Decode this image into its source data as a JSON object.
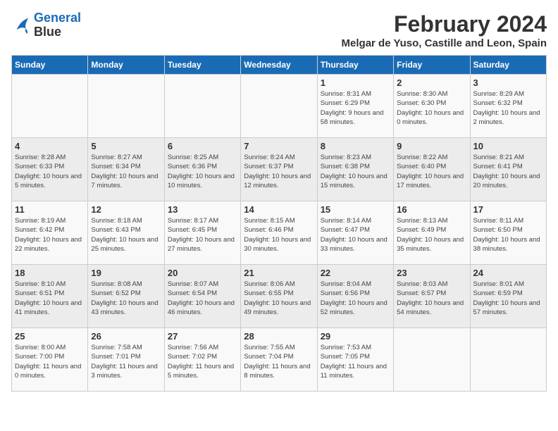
{
  "header": {
    "logo_line1": "General",
    "logo_line2": "Blue",
    "title": "February 2024",
    "subtitle": "Melgar de Yuso, Castille and Leon, Spain"
  },
  "columns": [
    "Sunday",
    "Monday",
    "Tuesday",
    "Wednesday",
    "Thursday",
    "Friday",
    "Saturday"
  ],
  "weeks": [
    [
      {
        "day": "",
        "detail": ""
      },
      {
        "day": "",
        "detail": ""
      },
      {
        "day": "",
        "detail": ""
      },
      {
        "day": "",
        "detail": ""
      },
      {
        "day": "1",
        "detail": "Sunrise: 8:31 AM\nSunset: 6:29 PM\nDaylight: 9 hours\nand 58 minutes."
      },
      {
        "day": "2",
        "detail": "Sunrise: 8:30 AM\nSunset: 6:30 PM\nDaylight: 10 hours\nand 0 minutes."
      },
      {
        "day": "3",
        "detail": "Sunrise: 8:29 AM\nSunset: 6:32 PM\nDaylight: 10 hours\nand 2 minutes."
      }
    ],
    [
      {
        "day": "4",
        "detail": "Sunrise: 8:28 AM\nSunset: 6:33 PM\nDaylight: 10 hours\nand 5 minutes."
      },
      {
        "day": "5",
        "detail": "Sunrise: 8:27 AM\nSunset: 6:34 PM\nDaylight: 10 hours\nand 7 minutes."
      },
      {
        "day": "6",
        "detail": "Sunrise: 8:25 AM\nSunset: 6:36 PM\nDaylight: 10 hours\nand 10 minutes."
      },
      {
        "day": "7",
        "detail": "Sunrise: 8:24 AM\nSunset: 6:37 PM\nDaylight: 10 hours\nand 12 minutes."
      },
      {
        "day": "8",
        "detail": "Sunrise: 8:23 AM\nSunset: 6:38 PM\nDaylight: 10 hours\nand 15 minutes."
      },
      {
        "day": "9",
        "detail": "Sunrise: 8:22 AM\nSunset: 6:40 PM\nDaylight: 10 hours\nand 17 minutes."
      },
      {
        "day": "10",
        "detail": "Sunrise: 8:21 AM\nSunset: 6:41 PM\nDaylight: 10 hours\nand 20 minutes."
      }
    ],
    [
      {
        "day": "11",
        "detail": "Sunrise: 8:19 AM\nSunset: 6:42 PM\nDaylight: 10 hours\nand 22 minutes."
      },
      {
        "day": "12",
        "detail": "Sunrise: 8:18 AM\nSunset: 6:43 PM\nDaylight: 10 hours\nand 25 minutes."
      },
      {
        "day": "13",
        "detail": "Sunrise: 8:17 AM\nSunset: 6:45 PM\nDaylight: 10 hours\nand 27 minutes."
      },
      {
        "day": "14",
        "detail": "Sunrise: 8:15 AM\nSunset: 6:46 PM\nDaylight: 10 hours\nand 30 minutes."
      },
      {
        "day": "15",
        "detail": "Sunrise: 8:14 AM\nSunset: 6:47 PM\nDaylight: 10 hours\nand 33 minutes."
      },
      {
        "day": "16",
        "detail": "Sunrise: 8:13 AM\nSunset: 6:49 PM\nDaylight: 10 hours\nand 35 minutes."
      },
      {
        "day": "17",
        "detail": "Sunrise: 8:11 AM\nSunset: 6:50 PM\nDaylight: 10 hours\nand 38 minutes."
      }
    ],
    [
      {
        "day": "18",
        "detail": "Sunrise: 8:10 AM\nSunset: 6:51 PM\nDaylight: 10 hours\nand 41 minutes."
      },
      {
        "day": "19",
        "detail": "Sunrise: 8:08 AM\nSunset: 6:52 PM\nDaylight: 10 hours\nand 43 minutes."
      },
      {
        "day": "20",
        "detail": "Sunrise: 8:07 AM\nSunset: 6:54 PM\nDaylight: 10 hours\nand 46 minutes."
      },
      {
        "day": "21",
        "detail": "Sunrise: 8:06 AM\nSunset: 6:55 PM\nDaylight: 10 hours\nand 49 minutes."
      },
      {
        "day": "22",
        "detail": "Sunrise: 8:04 AM\nSunset: 6:56 PM\nDaylight: 10 hours\nand 52 minutes."
      },
      {
        "day": "23",
        "detail": "Sunrise: 8:03 AM\nSunset: 6:57 PM\nDaylight: 10 hours\nand 54 minutes."
      },
      {
        "day": "24",
        "detail": "Sunrise: 8:01 AM\nSunset: 6:59 PM\nDaylight: 10 hours\nand 57 minutes."
      }
    ],
    [
      {
        "day": "25",
        "detail": "Sunrise: 8:00 AM\nSunset: 7:00 PM\nDaylight: 11 hours\nand 0 minutes."
      },
      {
        "day": "26",
        "detail": "Sunrise: 7:58 AM\nSunset: 7:01 PM\nDaylight: 11 hours\nand 3 minutes."
      },
      {
        "day": "27",
        "detail": "Sunrise: 7:56 AM\nSunset: 7:02 PM\nDaylight: 11 hours\nand 5 minutes."
      },
      {
        "day": "28",
        "detail": "Sunrise: 7:55 AM\nSunset: 7:04 PM\nDaylight: 11 hours\nand 8 minutes."
      },
      {
        "day": "29",
        "detail": "Sunrise: 7:53 AM\nSunset: 7:05 PM\nDaylight: 11 hours\nand 11 minutes."
      },
      {
        "day": "",
        "detail": ""
      },
      {
        "day": "",
        "detail": ""
      }
    ]
  ]
}
